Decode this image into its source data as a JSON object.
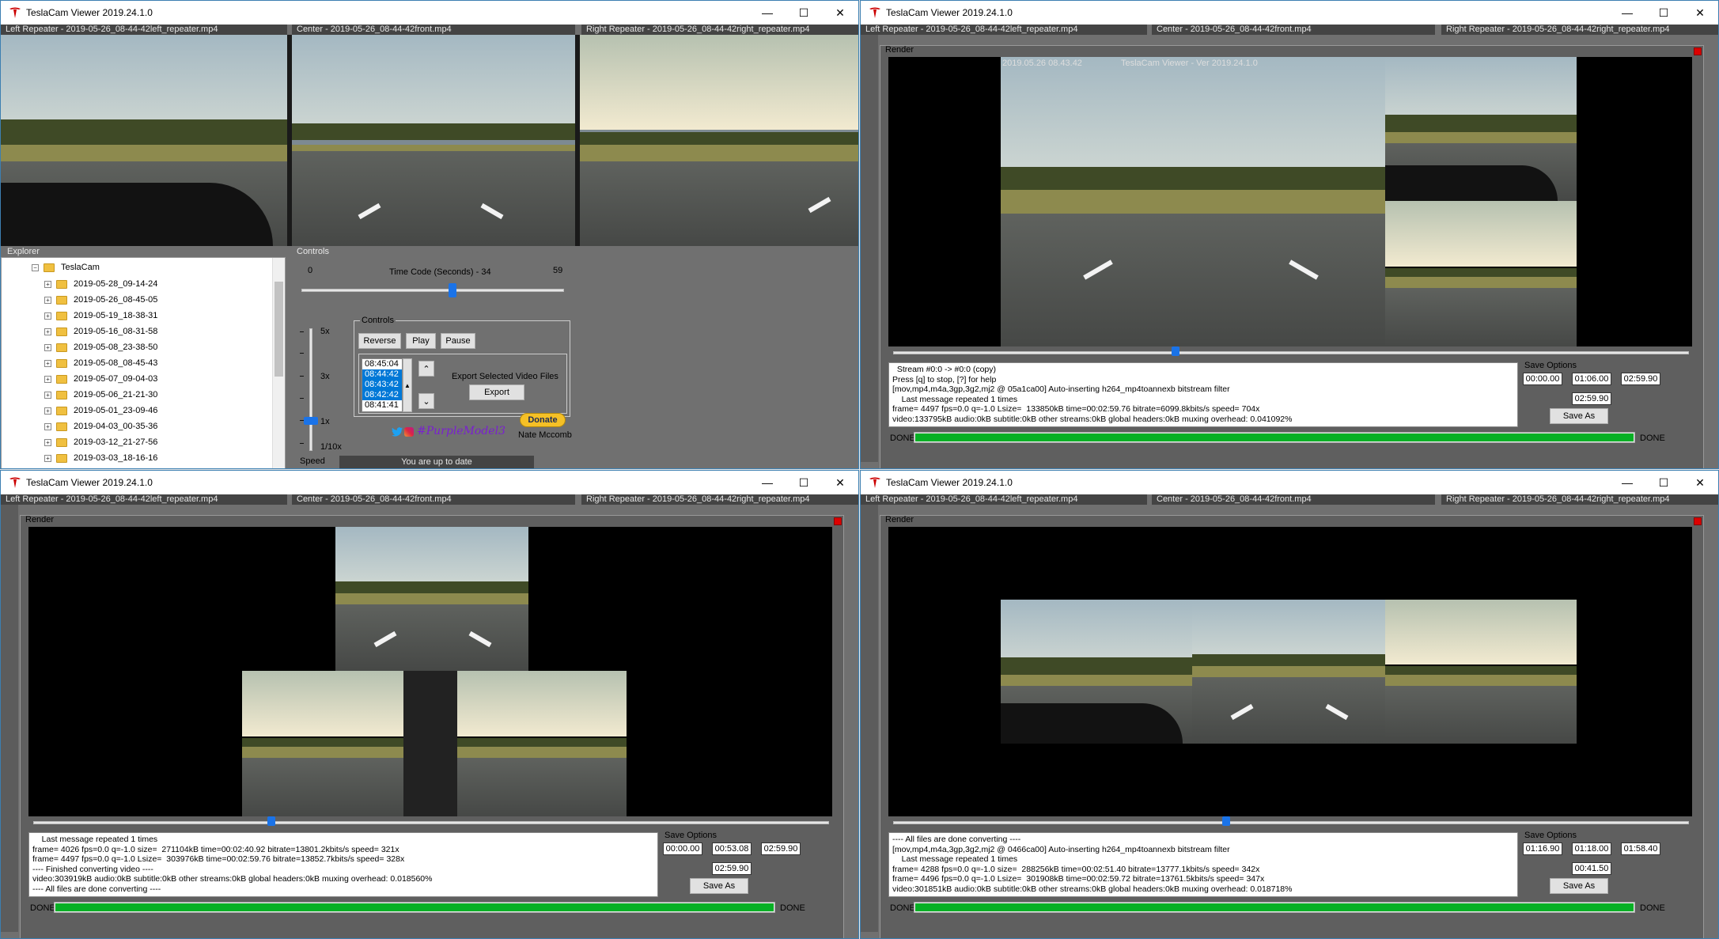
{
  "app_title": "TeslaCam Viewer 2019.24.1.0",
  "window_buttons": {
    "minimize": "—",
    "maximize": "☐",
    "close": "✕"
  },
  "cameras": {
    "left": "Left Repeater - 2019-05-26_08-44-42left_repeater.mp4",
    "center": "Center - 2019-05-26_08-44-42front.mp4",
    "right": "Right Repeater - 2019-05-26_08-44-42right_repeater.mp4"
  },
  "explorer": {
    "title": "Explorer",
    "root": "TeslaCam",
    "folders": [
      "2019-05-28_09-14-24",
      "2019-05-26_08-45-05",
      "2019-05-19_18-38-31",
      "2019-05-16_08-31-58",
      "2019-05-08_23-38-50",
      "2019-05-08_08-45-43",
      "2019-05-07_09-04-03",
      "2019-05-06_21-21-30",
      "2019-05-01_23-09-46",
      "2019-04-03_00-35-36",
      "2019-03-12_21-27-56",
      "2019-03-03_18-16-16"
    ],
    "partial": "2019-03-03_18-16-16"
  },
  "controls": {
    "title": "Controls",
    "time_min": "0",
    "time_max": "59",
    "time_label": "Time Code (Seconds) - 34",
    "time_value": 34,
    "speed_marks": [
      "5x",
      "3x",
      "1x",
      "1/10x"
    ],
    "speed_label": "Speed",
    "inner_title": "Controls",
    "reverse": "Reverse",
    "play": "Play",
    "pause": "Pause",
    "times": [
      "08:45:04",
      "08:44:42",
      "08:43:42",
      "08:42:42",
      "08:41:41"
    ],
    "export_label": "Export Selected Video Files",
    "export_btn": "Export",
    "social": "#PurpleModel3",
    "donate": "Donate",
    "author": "Nate Mccomb",
    "status": "You are up to date"
  },
  "render": {
    "title": "Render",
    "save_options": "Save Options",
    "save_as": "Save As",
    "done": "DONE",
    "overlay_date": "2019.05.26  08.43.42",
    "overlay_title": "TeslaCam Viewer - Ver 2019.24.1.0",
    "win2": {
      "log": "  Stream #0:0 -> #0:0 (copy)\nPress [q] to stop, [?] for help\n[mov,mp4,m4a,3gp,3g2,mj2 @ 05a1ca00] Auto-inserting h264_mp4toannexb bitstream filter\n    Last message repeated 1 times\nframe= 4497 fps=0.0 q=-1.0 Lsize=  133850kB time=00:02:59.76 bitrate=6099.8kbits/s speed= 704x\nvideo:133795kB audio:0kB subtitle:0kB other streams:0kB global headers:0kB muxing overhead: 0.041092%",
      "t1": "00:00.00",
      "t2": "01:06.00",
      "t3": "02:59.90",
      "t4": "02:59.90",
      "progress": 1.0,
      "pos": 0.37
    },
    "win3": {
      "log": "    Last message repeated 1 times\nframe= 4026 fps=0.0 q=-1.0 size=  271104kB time=00:02:40.92 bitrate=13801.2kbits/s speed= 321x\nframe= 4497 fps=0.0 q=-1.0 Lsize=  303976kB time=00:02:59.76 bitrate=13852.7kbits/s speed= 328x\n---- Finished converting video ----\nvideo:303919kB audio:0kB subtitle:0kB other streams:0kB global headers:0kB muxing overhead: 0.018560%\n---- All files are done converting ----",
      "t1": "00:00.00",
      "t2": "00:53.08",
      "t3": "02:59.90",
      "t4": "02:59.90",
      "progress": 1.0,
      "pos": 0.3
    },
    "win4": {
      "log": "---- All files are done converting ----\n[mov,mp4,m4a,3gp,3g2,mj2 @ 0466ca00] Auto-inserting h264_mp4toannexb bitstream filter\n    Last message repeated 1 times\nframe= 4288 fps=0.0 q=-1.0 size=  288256kB time=00:02:51.40 bitrate=13777.1kbits/s speed= 342x\nframe= 4496 fps=0.0 q=-1.0 Lsize=  301908kB time=00:02:59.72 bitrate=13761.5kbits/s speed= 347x\nvideo:301851kB audio:0kB subtitle:0kB other streams:0kB global headers:0kB muxing overhead: 0.018718%",
      "t1": "01:16.90",
      "t2": "01:18.00",
      "t3": "01:58.40",
      "t4": "00:41.50",
      "progress": 1.0,
      "pos": 0.43
    }
  },
  "colors": {
    "accent": "#1a73e8",
    "progress": "#06b025",
    "tesla_red": "#cc0000",
    "donate": "#f5c026"
  }
}
